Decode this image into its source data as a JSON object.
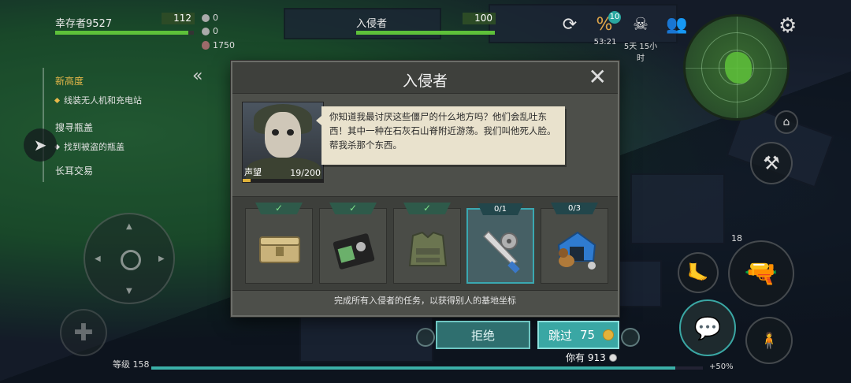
{
  "hud": {
    "player_name": "幸存者9527",
    "player_hp": "112",
    "enemy_name": "入侵者",
    "enemy_hp": "100",
    "stat_kills": "0",
    "stat_other": "0",
    "stat_eggs": "1750",
    "timer": "53:21",
    "badge_count": "10",
    "days_label": "5天 15小时",
    "level_label": "等级 158",
    "xp_pct": "+50%"
  },
  "quests": [
    {
      "title": "新高度",
      "sub": "线装无人机和充电站",
      "highlight": true
    },
    {
      "title": "搜寻瓶盖",
      "sub": "找到被盗的瓶盖",
      "highlight": false
    },
    {
      "title": "长耳交易",
      "sub": "",
      "highlight": false
    }
  ],
  "right_numbers": {
    "count": "18"
  },
  "dialog": {
    "title": "入侵者",
    "reputation_label": "声望",
    "reputation_value": "19/200",
    "reputation_fraction": 0.095,
    "speech": "你知道我最讨厌这些僵尸的什么地方吗？他们会乱吐东西！其中一种在石灰石山脊附近游荡。我们叫他死人脸。帮我杀那个东西。",
    "tasks": [
      {
        "tag": "✓",
        "item": "ammo-crate",
        "done": true
      },
      {
        "tag": "✓",
        "item": "wallet-badge",
        "done": true
      },
      {
        "tag": "✓",
        "item": "armor-vest",
        "done": true
      },
      {
        "tag": "0/1",
        "item": "machete-saw",
        "done": false
      },
      {
        "tag": "0/3",
        "item": "dog-kennel",
        "done": false
      }
    ],
    "footer": "完成所有入侵者的任务，以获得别人的基地坐标",
    "refuse_label": "拒绝",
    "skip_label": "跳过",
    "skip_cost": "75",
    "you_have_label": "你有 913"
  },
  "colors": {
    "accent": "#3aa7a4",
    "hp_green": "#5ec13a",
    "quest_gold": "#e8b84a",
    "dialog_bg": "#4d4f4a"
  }
}
